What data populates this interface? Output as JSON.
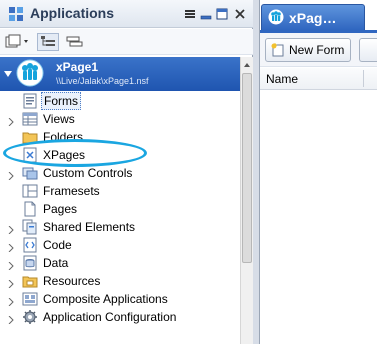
{
  "left_panel": {
    "title": "Applications",
    "app": {
      "name": "xPage1",
      "path": "\\\\Live/Jalak\\xPage1.nsf"
    },
    "tree_items": [
      {
        "label": "Forms",
        "icon": "forms-icon",
        "expandable": false,
        "selected": true
      },
      {
        "label": "Views",
        "icon": "views-icon",
        "expandable": true,
        "selected": false
      },
      {
        "label": "Folders",
        "icon": "folder-icon",
        "expandable": false,
        "selected": false
      },
      {
        "label": "XPages",
        "icon": "xpages-icon",
        "expandable": false,
        "selected": false
      },
      {
        "label": "Custom Controls",
        "icon": "custom-controls-icon",
        "expandable": true,
        "selected": false
      },
      {
        "label": "Framesets",
        "icon": "framesets-icon",
        "expandable": false,
        "selected": false
      },
      {
        "label": "Pages",
        "icon": "pages-icon",
        "expandable": false,
        "selected": false
      },
      {
        "label": "Shared Elements",
        "icon": "shared-elements-icon",
        "expandable": true,
        "selected": false
      },
      {
        "label": "Code",
        "icon": "code-icon",
        "expandable": true,
        "selected": false
      },
      {
        "label": "Data",
        "icon": "data-icon",
        "expandable": true,
        "selected": false
      },
      {
        "label": "Resources",
        "icon": "resources-icon",
        "expandable": true,
        "selected": false
      },
      {
        "label": "Composite Applications",
        "icon": "composite-applications-icon",
        "expandable": true,
        "selected": false
      },
      {
        "label": "Application Configuration",
        "icon": "application-configuration-icon",
        "expandable": true,
        "selected": false
      }
    ]
  },
  "right_panel": {
    "tab_label": "xPag…",
    "new_form_label": "New Form",
    "column_header": "Name"
  },
  "colors": {
    "selection_header": "#2a62bd",
    "highlight_oval": "#1aa6e1",
    "tab": "#3f78cf"
  }
}
